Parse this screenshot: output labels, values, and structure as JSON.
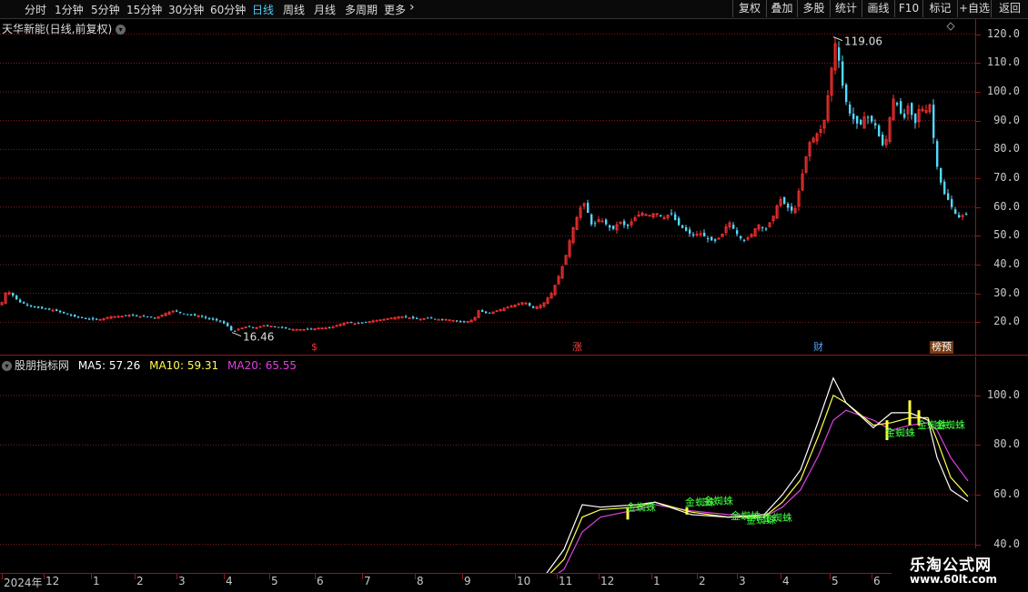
{
  "toolbar": {
    "periods": [
      "分时",
      "1分钟",
      "5分钟",
      "15分钟",
      "30分钟",
      "60分钟",
      "日线",
      "周线",
      "月线",
      "多周期",
      "更多"
    ],
    "active_period": "日线",
    "right_buttons": [
      "复权",
      "叠加",
      "多股",
      "统计",
      "画线",
      "F10",
      "标记",
      "+自选",
      "返回"
    ]
  },
  "main_chart": {
    "title": "天华新能(日线,前复权)",
    "y_ticks": [
      "120.0",
      "110.0",
      "100.0",
      "90.0",
      "80.0",
      "70.0",
      "60.0",
      "50.0",
      "40.0",
      "30.0",
      "20.0"
    ],
    "high_label": "119.06",
    "low_label": "16.46",
    "markers": [
      {
        "text": "$",
        "color": "#ff3030"
      },
      {
        "text": "涨",
        "color": "#ff4040"
      },
      {
        "text": "财",
        "color": "#4da6ff"
      },
      {
        "text": "榜预",
        "color": "#ff8c1a"
      }
    ],
    "colors": {
      "up": "#ff3232",
      "down": "#54d8ff",
      "grid": "#8b1a1a"
    }
  },
  "indicator": {
    "name": "股朋指标网",
    "ma5_label": "MA5:",
    "ma5_value": "57.26",
    "ma10_label": "MA10:",
    "ma10_value": "59.31",
    "ma20_label": "MA20:",
    "ma20_value": "65.55",
    "y_ticks": [
      "100.0",
      "80.0",
      "60.0",
      "40.0"
    ],
    "signal_text": "金蜘蛛",
    "colors": {
      "ma5": "#ffffff",
      "ma10": "#ffff50",
      "ma20": "#e040e0",
      "signal": "#40ff40",
      "bar": "#ffff40"
    }
  },
  "time_axis": {
    "labels": [
      "2024年",
      "12",
      "1",
      "2",
      "3",
      "4",
      "5",
      "6",
      "7",
      "8",
      "9",
      "10",
      "11",
      "12",
      "1",
      "2",
      "3",
      "4",
      "5",
      "6"
    ]
  },
  "watermark": {
    "title": "乐淘公式网",
    "url": "www.60lt.com"
  },
  "chart_data": {
    "type": "candlestick",
    "title": "天华新能(日线,前复权)",
    "ylim": [
      10,
      124
    ],
    "y_ticks": [
      120,
      110,
      100,
      90,
      80,
      70,
      60,
      50,
      40,
      30,
      20
    ],
    "high": 119.06,
    "low": 16.46,
    "x_months": [
      "2024年",
      "12",
      "1",
      "2",
      "3",
      "4",
      "5",
      "6",
      "7",
      "8",
      "9",
      "10",
      "11",
      "12",
      "1",
      "2",
      "3",
      "4",
      "5",
      "6"
    ],
    "close_path": [
      [
        0,
        26
      ],
      [
        6,
        31
      ],
      [
        14,
        29
      ],
      [
        20,
        27
      ],
      [
        30,
        26
      ],
      [
        40,
        25
      ],
      [
        50,
        24.5
      ],
      [
        60,
        24
      ],
      [
        70,
        23
      ],
      [
        80,
        22
      ],
      [
        90,
        21.5
      ],
      [
        100,
        21
      ],
      [
        110,
        21
      ],
      [
        120,
        22
      ],
      [
        130,
        22
      ],
      [
        140,
        22.5
      ],
      [
        150,
        22
      ],
      [
        160,
        22
      ],
      [
        170,
        21.5
      ],
      [
        180,
        23
      ],
      [
        190,
        24
      ],
      [
        200,
        23
      ],
      [
        210,
        22.5
      ],
      [
        220,
        22
      ],
      [
        230,
        21
      ],
      [
        240,
        20.5
      ],
      [
        248,
        19
      ],
      [
        252,
        17.5
      ],
      [
        255,
        16.6
      ],
      [
        260,
        17.5
      ],
      [
        270,
        18.5
      ],
      [
        280,
        18
      ],
      [
        290,
        19
      ],
      [
        300,
        18.5
      ],
      [
        310,
        18
      ],
      [
        320,
        17.5
      ],
      [
        330,
        17.5
      ],
      [
        340,
        17.5
      ],
      [
        350,
        18
      ],
      [
        360,
        18
      ],
      [
        370,
        19
      ],
      [
        380,
        20
      ],
      [
        390,
        19.5
      ],
      [
        400,
        20
      ],
      [
        410,
        20.5
      ],
      [
        420,
        21
      ],
      [
        430,
        21.5
      ],
      [
        440,
        22
      ],
      [
        450,
        21.5
      ],
      [
        460,
        21
      ],
      [
        470,
        21.5
      ],
      [
        480,
        21
      ],
      [
        490,
        21
      ],
      [
        500,
        20.5
      ],
      [
        510,
        20
      ],
      [
        520,
        21
      ],
      [
        525,
        24
      ],
      [
        535,
        23
      ],
      [
        545,
        24
      ],
      [
        555,
        25
      ],
      [
        565,
        26
      ],
      [
        575,
        27
      ],
      [
        585,
        25
      ],
      [
        595,
        26
      ],
      [
        605,
        30
      ],
      [
        612,
        35
      ],
      [
        620,
        42
      ],
      [
        628,
        52
      ],
      [
        635,
        58
      ],
      [
        640,
        62
      ],
      [
        645,
        58
      ],
      [
        650,
        53
      ],
      [
        658,
        56
      ],
      [
        665,
        54
      ],
      [
        672,
        52
      ],
      [
        680,
        55
      ],
      [
        688,
        53
      ],
      [
        696,
        56
      ],
      [
        704,
        58
      ],
      [
        712,
        57
      ],
      [
        720,
        58
      ],
      [
        728,
        56
      ],
      [
        736,
        58
      ],
      [
        744,
        54
      ],
      [
        752,
        52
      ],
      [
        760,
        50
      ],
      [
        768,
        51
      ],
      [
        776,
        49
      ],
      [
        784,
        48
      ],
      [
        792,
        50
      ],
      [
        800,
        55
      ],
      [
        808,
        51
      ],
      [
        816,
        48
      ],
      [
        824,
        50
      ],
      [
        832,
        54
      ],
      [
        840,
        52
      ],
      [
        848,
        56
      ],
      [
        856,
        63
      ],
      [
        864,
        60
      ],
      [
        872,
        58
      ],
      [
        880,
        70
      ],
      [
        888,
        82
      ],
      [
        896,
        85
      ],
      [
        904,
        88
      ],
      [
        912,
        105
      ],
      [
        916,
        118
      ],
      [
        920,
        113
      ],
      [
        926,
        100
      ],
      [
        932,
        93
      ],
      [
        938,
        90
      ],
      [
        944,
        88
      ],
      [
        950,
        92
      ],
      [
        956,
        90
      ],
      [
        962,
        88
      ],
      [
        968,
        81
      ],
      [
        974,
        84
      ],
      [
        980,
        98
      ],
      [
        986,
        95
      ],
      [
        992,
        90
      ],
      [
        998,
        96
      ],
      [
        1004,
        88
      ],
      [
        1010,
        95
      ],
      [
        1016,
        93
      ],
      [
        1022,
        96
      ],
      [
        1026,
        80
      ],
      [
        1030,
        72
      ],
      [
        1036,
        65
      ],
      [
        1042,
        62
      ],
      [
        1048,
        58
      ],
      [
        1054,
        56
      ],
      [
        1060,
        58
      ],
      [
        1064,
        55
      ]
    ],
    "ma_series": [
      {
        "name": "MA5",
        "values": [
          [
            0,
            28
          ],
          [
            40,
            27
          ],
          [
            100,
            23.5
          ],
          [
            160,
            22.5
          ],
          [
            220,
            22.5
          ],
          [
            280,
            18.5
          ],
          [
            340,
            17.7
          ],
          [
            400,
            20
          ],
          [
            460,
            21.5
          ],
          [
            520,
            21
          ],
          [
            560,
            24.5
          ],
          [
            600,
            28
          ],
          [
            620,
            38
          ],
          [
            640,
            56
          ],
          [
            660,
            55
          ],
          [
            700,
            56
          ],
          [
            720,
            57
          ],
          [
            760,
            52
          ],
          [
            800,
            51
          ],
          [
            840,
            52
          ],
          [
            860,
            60
          ],
          [
            880,
            70
          ],
          [
            900,
            90
          ],
          [
            916,
            107
          ],
          [
            930,
            97
          ],
          [
            960,
            87
          ],
          [
            980,
            93
          ],
          [
            1000,
            93
          ],
          [
            1020,
            90
          ],
          [
            1030,
            75
          ],
          [
            1045,
            62
          ],
          [
            1064,
            57.26
          ]
        ]
      },
      {
        "name": "MA10",
        "values": [
          [
            0,
            27.5
          ],
          [
            40,
            27
          ],
          [
            100,
            23.5
          ],
          [
            160,
            22.5
          ],
          [
            220,
            22.5
          ],
          [
            280,
            18.5
          ],
          [
            340,
            17.8
          ],
          [
            400,
            19.8
          ],
          [
            460,
            21.5
          ],
          [
            520,
            21
          ],
          [
            560,
            24
          ],
          [
            600,
            26.5
          ],
          [
            620,
            34
          ],
          [
            640,
            51
          ],
          [
            660,
            54
          ],
          [
            700,
            55
          ],
          [
            720,
            57
          ],
          [
            760,
            53
          ],
          [
            800,
            51
          ],
          [
            840,
            51
          ],
          [
            860,
            57
          ],
          [
            880,
            66
          ],
          [
            900,
            84
          ],
          [
            916,
            100
          ],
          [
            930,
            97
          ],
          [
            960,
            88
          ],
          [
            980,
            89
          ],
          [
            1000,
            91
          ],
          [
            1020,
            91
          ],
          [
            1030,
            82
          ],
          [
            1045,
            67
          ],
          [
            1064,
            59.31
          ]
        ]
      },
      {
        "name": "MA20",
        "values": [
          [
            0,
            27
          ],
          [
            40,
            27
          ],
          [
            100,
            24
          ],
          [
            160,
            23
          ],
          [
            220,
            23
          ],
          [
            280,
            19
          ],
          [
            340,
            18
          ],
          [
            400,
            19.5
          ],
          [
            460,
            21.5
          ],
          [
            520,
            21.5
          ],
          [
            560,
            23.5
          ],
          [
            600,
            25
          ],
          [
            620,
            30
          ],
          [
            640,
            45
          ],
          [
            660,
            51
          ],
          [
            700,
            54
          ],
          [
            720,
            56
          ],
          [
            760,
            53.5
          ],
          [
            800,
            52
          ],
          [
            840,
            51
          ],
          [
            860,
            55
          ],
          [
            880,
            62
          ],
          [
            900,
            76
          ],
          [
            916,
            90
          ],
          [
            930,
            94
          ],
          [
            960,
            90
          ],
          [
            980,
            86
          ],
          [
            1000,
            88
          ],
          [
            1020,
            89
          ],
          [
            1030,
            86
          ],
          [
            1045,
            75
          ],
          [
            1064,
            65.55
          ]
        ]
      }
    ],
    "indicator_ylim": [
      30,
      112
    ],
    "indicator_ticks": [
      100,
      80,
      60,
      40
    ],
    "signals": [
      {
        "x": 45,
        "v": 24.5
      },
      {
        "x": 160,
        "v": 23
      },
      {
        "x": 178,
        "v": 23
      },
      {
        "x": 195,
        "v": 22.5
      },
      {
        "x": 360,
        "v": 18.4
      },
      {
        "x": 378,
        "v": 18.4
      },
      {
        "x": 398,
        "v": 18.6
      },
      {
        "x": 485,
        "v": 21.8
      },
      {
        "x": 520,
        "v": 21
      },
      {
        "x": 540,
        "v": 22
      },
      {
        "x": 575,
        "v": 24.5
      },
      {
        "x": 590,
        "v": 23.5
      },
      {
        "x": 610,
        "v": 24.8
      },
      {
        "x": 690,
        "v": 53.6
      },
      {
        "x": 755,
        "v": 55.6
      },
      {
        "x": 775,
        "v": 56.2
      },
      {
        "x": 805,
        "v": 50.2
      },
      {
        "x": 822,
        "v": 48.4
      },
      {
        "x": 840,
        "v": 49.4
      },
      {
        "x": 975,
        "v": 83.6
      },
      {
        "x": 1010,
        "v": 86.8
      },
      {
        "x": 1030,
        "v": 86.7
      }
    ],
    "signal_bars": [
      {
        "x": 690,
        "v1": 50,
        "v2": 55
      },
      {
        "x": 755,
        "v1": 52,
        "v2": 55
      },
      {
        "x": 520,
        "v1": 19,
        "v2": 23
      },
      {
        "x": 975,
        "v1": 82,
        "v2": 90
      },
      {
        "x": 1000,
        "v1": 88,
        "v2": 98
      },
      {
        "x": 1010,
        "v1": 88,
        "v2": 94
      }
    ]
  }
}
